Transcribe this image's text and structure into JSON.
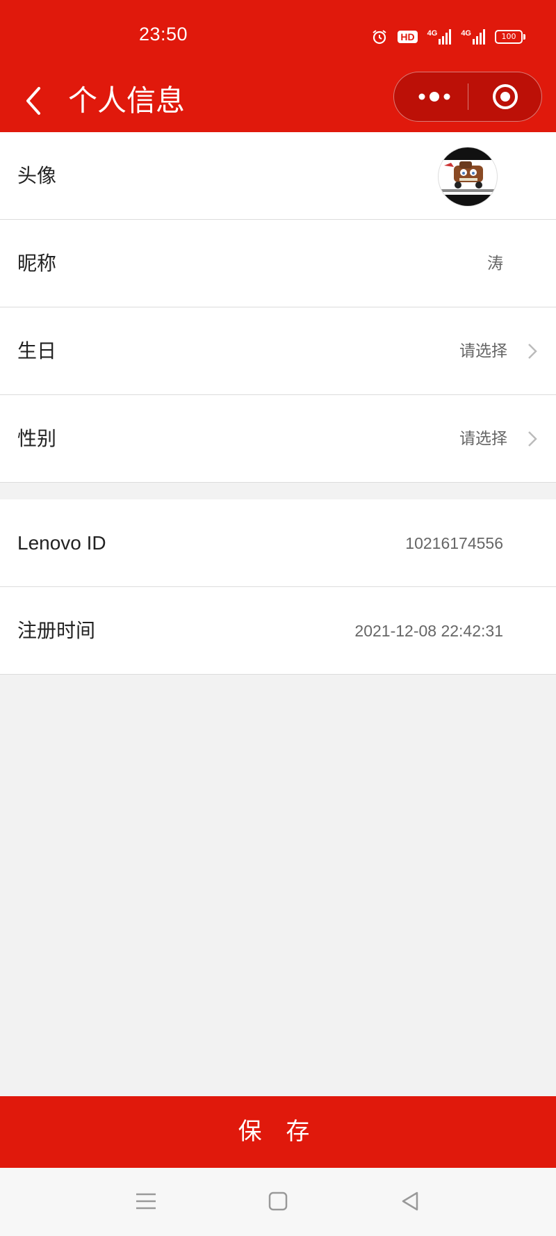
{
  "status_bar": {
    "time": "23:50",
    "hd_label": "HD",
    "net1": "4G",
    "net2": "4G",
    "battery": "100",
    "icons": [
      "alarm-icon",
      "hd-voice-icon",
      "signal-4g-icon",
      "signal-4g-icon",
      "battery-icon"
    ]
  },
  "navbar": {
    "title": "个人信息",
    "back_icon": "chevron-left-icon",
    "more_icon": "more-dots-icon",
    "close_icon": "target-circle-icon"
  },
  "profile": {
    "avatar_label": "头像",
    "nickname_label": "昵称",
    "nickname_value": "涛",
    "birthday_label": "生日",
    "birthday_value": "请选择",
    "gender_label": "性别",
    "gender_value": "请选择"
  },
  "account": {
    "id_label": "Lenovo ID",
    "id_value": "10216174556",
    "register_label": "注册时间",
    "register_value": "2021-12-08 22:42:31"
  },
  "actions": {
    "save_label": "保 存"
  },
  "colors": {
    "brand_red": "#e0190c",
    "page_bg": "#f2f2f2"
  }
}
